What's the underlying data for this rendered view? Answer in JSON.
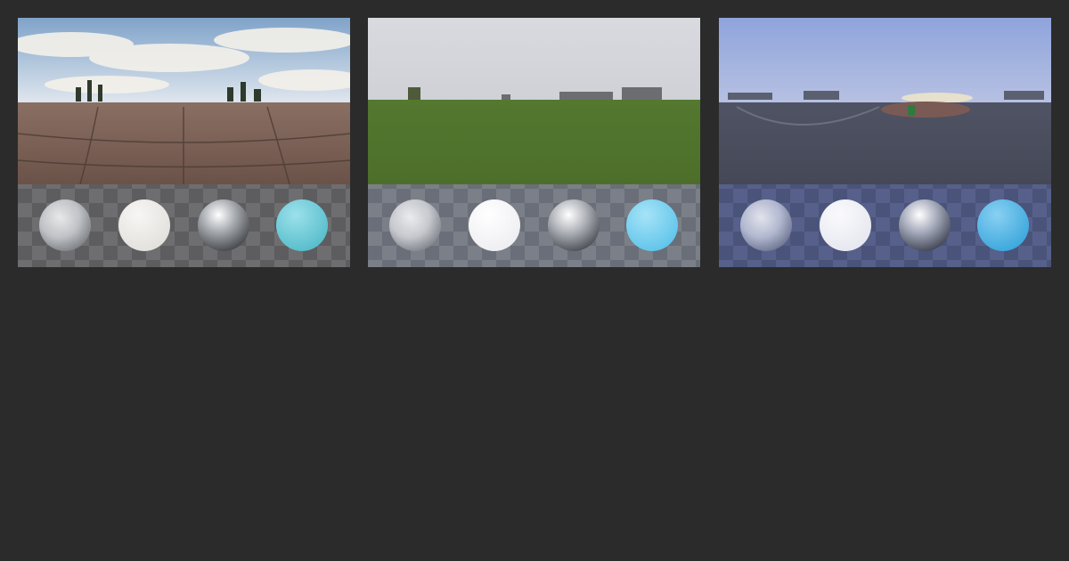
{
  "page": {
    "background": "#2b2b2b"
  },
  "thumbnails": [
    {
      "id": "card-0",
      "scene": "paved-plaza-cloudy-sky",
      "colors": {
        "sky_top": "#7fa3c9",
        "sky_bottom": "#dfe6ee",
        "cloud": "#f4f1ea",
        "ground_top": "#8a6f63",
        "ground_bottom": "#6b5248",
        "floor": "#6e6e70",
        "floor_alt": "#5d5d60",
        "sphere_diffuse": "#e2e0dc",
        "sphere_colored": "#56bccb"
      }
    },
    {
      "id": "card-1",
      "scene": "grass-field-overcast",
      "colors": {
        "sky_top": "#d8dae0",
        "sky_bottom": "#cfd1d6",
        "cloud": "#e6e7ea",
        "ground_top": "#54782f",
        "ground_bottom": "#4c6e2a",
        "floor": "#7b7f88",
        "floor_alt": "#6a6e78",
        "sphere_diffuse": "#eeeef2",
        "sphere_colored": "#5ec4ea"
      }
    },
    {
      "id": "card-2",
      "scene": "asphalt-lot-dusk",
      "colors": {
        "sky_top": "#8fa4dc",
        "sky_bottom": "#b6c0e2",
        "cloud": "#c8ccea",
        "ground_top": "#4f5363",
        "ground_bottom": "#454857",
        "floor": "#56608a",
        "floor_alt": "#4a5379",
        "sphere_diffuse": "#e6e7ef",
        "sphere_colored": "#3aa6dc"
      }
    }
  ]
}
